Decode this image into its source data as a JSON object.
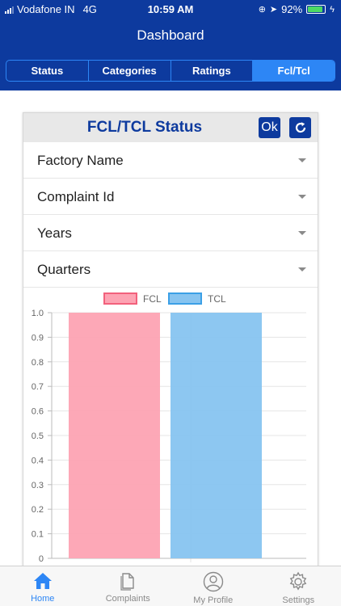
{
  "status_bar": {
    "carrier": "Vodafone IN",
    "network": "4G",
    "time": "10:59 AM",
    "battery": "92%"
  },
  "header": {
    "title": "Dashboard"
  },
  "segments": [
    {
      "label": "Status",
      "active": false
    },
    {
      "label": "Categories",
      "active": false
    },
    {
      "label": "Ratings",
      "active": false
    },
    {
      "label": "Fcl/Tcl",
      "active": true
    }
  ],
  "card": {
    "title": "FCL/TCL Status",
    "ok_label": "Ok",
    "dropdowns": [
      {
        "label": "Factory Name"
      },
      {
        "label": "Complaint Id"
      },
      {
        "label": "Years"
      },
      {
        "label": "Quarters"
      }
    ]
  },
  "chart_data": {
    "type": "bar",
    "series": [
      {
        "name": "FCL",
        "values": [
          1.0
        ],
        "color": "#fda3b3",
        "border": "#f2617c"
      },
      {
        "name": "TCL",
        "values": [
          1.0
        ],
        "color": "#87c4f0",
        "border": "#3ca0e6"
      }
    ],
    "ylim": [
      0,
      1.0
    ],
    "yticks": [
      "0",
      "0.1",
      "0.2",
      "0.3",
      "0.4",
      "0.5",
      "0.6",
      "0.7",
      "0.8",
      "0.9",
      "1.0"
    ],
    "legend": "top-center",
    "grid": true
  },
  "tabbar": [
    {
      "label": "Home",
      "icon": "home-icon",
      "active": true
    },
    {
      "label": "Complaints",
      "icon": "document-icon",
      "active": false
    },
    {
      "label": "My Profile",
      "icon": "profile-icon",
      "active": false
    },
    {
      "label": "Settings",
      "icon": "gear-icon",
      "active": false
    }
  ]
}
